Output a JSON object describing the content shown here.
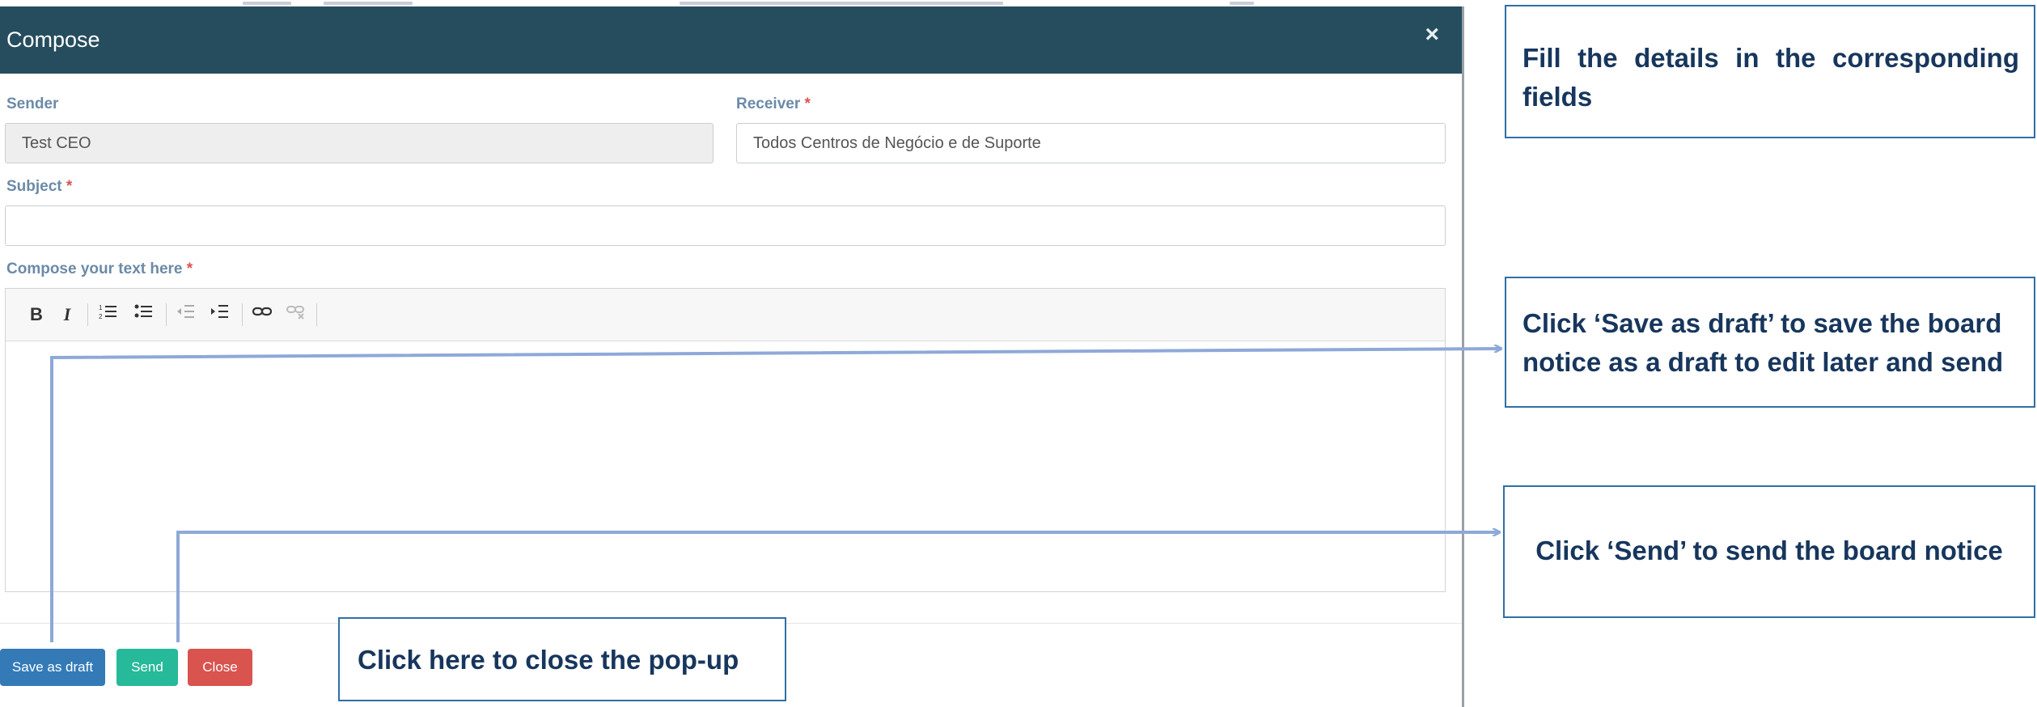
{
  "dialog": {
    "title": "Compose",
    "close_symbol": "×"
  },
  "form": {
    "sender_label": "Sender",
    "sender_value": "Test CEO",
    "receiver_label": "Receiver",
    "receiver_value": "Todos Centros de Negócio e de Suporte",
    "subject_label": "Subject",
    "subject_value": "",
    "body_label": "Compose your text here",
    "required_mark": "*"
  },
  "toolbar": {
    "bold": "B",
    "italic": "I",
    "icons": [
      "ordered-list-icon",
      "unordered-list-icon",
      "outdent-icon",
      "indent-icon",
      "link-icon",
      "unlink-icon"
    ]
  },
  "footer": {
    "save_draft_label": "Save as draft",
    "send_label": "Send",
    "close_label": "Close"
  },
  "callouts": {
    "fill_details": "Fill the details in the corresponding fields",
    "save_draft": "Click ‘Save as draft’ to save the board notice as a draft to edit later and send",
    "send": "Click ‘Send’ to send the board notice",
    "close": "Click  here to close the pop-up"
  },
  "colors": {
    "header_bg": "#264d5e",
    "label": "#6b8aa8",
    "required": "#d9534f",
    "draft_button": "#337ab7",
    "send_button": "#26b99a",
    "close_button": "#d9534f",
    "callout_text": "#17365d",
    "callout_border": "#2f6fa6",
    "arrow": "#8ea9d8"
  }
}
